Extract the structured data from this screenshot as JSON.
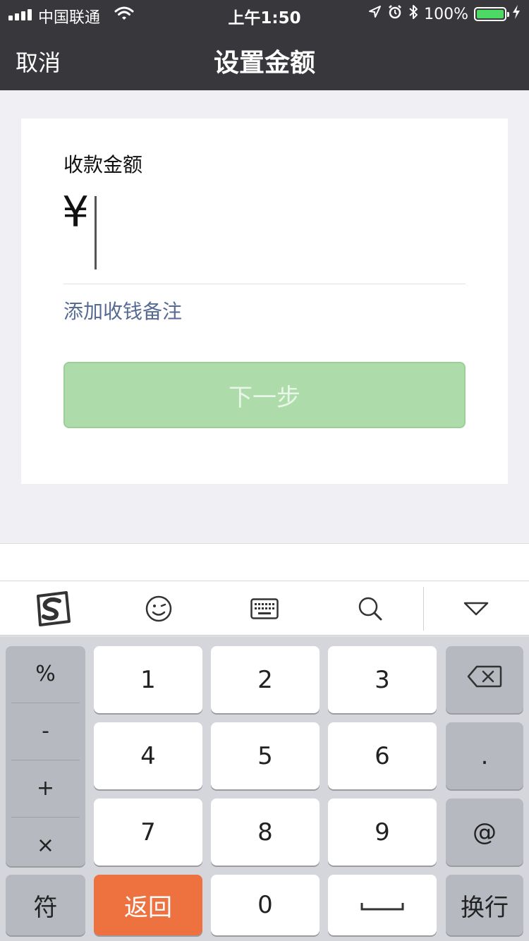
{
  "status_bar": {
    "carrier": "中国联通",
    "time": "上午1:50",
    "battery": "100%",
    "colors": {
      "battery_fill": "#4cd964"
    }
  },
  "nav": {
    "cancel_label": "取消",
    "title": "设置金额"
  },
  "form": {
    "amount_label": "收款金额",
    "currency_symbol": "¥",
    "amount_value": "",
    "remark_link": "添加收钱备注",
    "next_button": "下一步",
    "colors": {
      "link": "#576b95",
      "button_bg": "#addcaa",
      "button_text": "#e8f6e7"
    }
  },
  "keyboard_toolbar": {
    "icons": [
      "sogou-logo-icon",
      "emoji-icon",
      "keyboard-icon",
      "search-icon",
      "collapse-keyboard-icon"
    ]
  },
  "keyboard": {
    "symbols": [
      "%",
      "-",
      "+",
      "×"
    ],
    "digits": [
      "1",
      "2",
      "3",
      "4",
      "5",
      "6",
      "7",
      "8",
      "9",
      "0"
    ],
    "right_keys": {
      "dot": ".",
      "at": "@",
      "newline": "换行"
    },
    "bottom_keys": {
      "symbol": "符",
      "back": "返回"
    },
    "icons": {
      "delete": "backspace-icon",
      "space": "space-icon"
    },
    "colors": {
      "back_key": "#ee7140"
    }
  }
}
